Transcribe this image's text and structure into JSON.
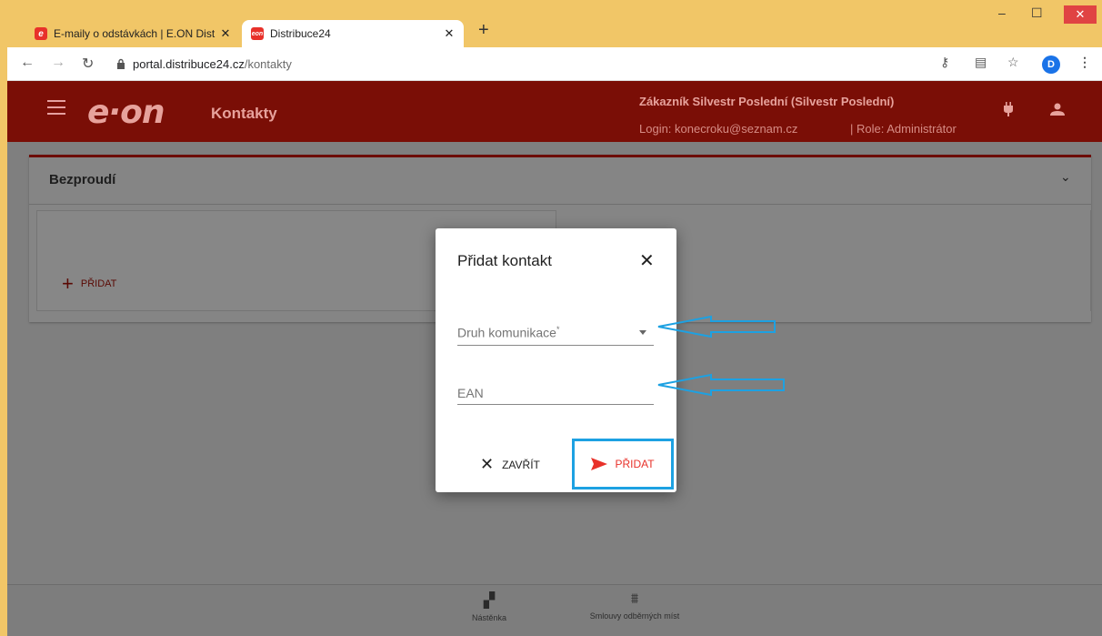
{
  "browser": {
    "tabs": [
      {
        "title": "E-maily o odstávkách | E.ON Dist",
        "favicon": "eon-red-icon"
      },
      {
        "title": "Distribuce24",
        "favicon": "eon-small-logo-icon"
      }
    ],
    "new_tab": "+",
    "url_host": "portal.distribuce24.cz",
    "url_path": "/kontakty",
    "profile_initial": "D"
  },
  "header": {
    "logo": "e·on",
    "page_title": "Kontakty",
    "customer_label": "Zákazník",
    "customer_name": "Silvestr Poslední (Silvestr Poslední)",
    "login": "Login: konecroku@seznam.cz",
    "role": "| Role: Administrátor"
  },
  "card": {
    "title": "Bezproudí",
    "add_label": "PŘIDAT"
  },
  "dialog": {
    "title": "Přidat kontakt",
    "field1_label": "Druh komunikace",
    "field1_required": "*",
    "field2_label": "EAN",
    "close_label": "ZAVŘÍT",
    "submit_label": "PŘIDAT"
  },
  "bottom_nav": [
    {
      "label": "Nástěnka",
      "icon": "dashboard-icon"
    },
    {
      "label": "Smlouvy odběrných míst",
      "icon": "meters-icon"
    }
  ],
  "colors": {
    "brand_red": "#7a0e06",
    "accent_red": "#e8312a",
    "annotation_blue": "#1da1e2",
    "chrome_yellow": "#f1c667"
  }
}
